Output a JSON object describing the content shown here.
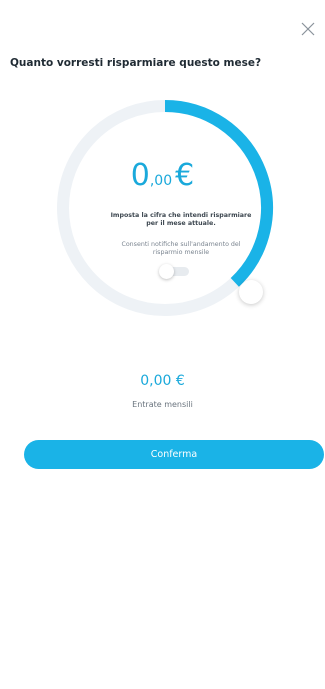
{
  "header": {
    "close_icon": "close-icon",
    "title": "Quanto vorresti risparmiare questo mese?"
  },
  "savings_dial": {
    "progress_fraction": 0.38,
    "amount_integer": "0",
    "amount_decimal": ",00",
    "currency": "€",
    "hint": "Imposta la cifra che intendi risparmiare per il mese attuale.",
    "notifications_label": "Consenti notifiche sull'andamento del risparmio mensile",
    "notifications_enabled": false
  },
  "income": {
    "value": "0,00 €",
    "label": "Entrate mensili"
  },
  "actions": {
    "confirm_label": "Conferma"
  },
  "colors": {
    "accent": "#1ab3e7",
    "track": "#eef2f6",
    "title_text": "#1f2a33"
  }
}
